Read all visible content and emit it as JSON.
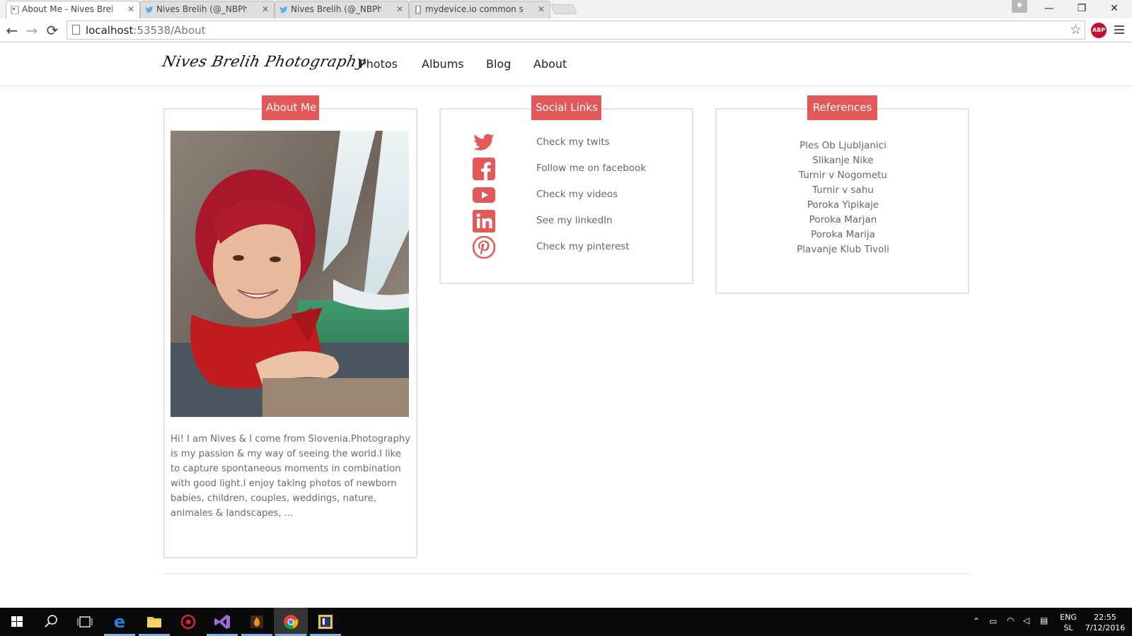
{
  "browser": {
    "tabs": [
      {
        "title": "About Me - Nives Brelih P",
        "active": true
      },
      {
        "title": "Nives Brelih (@_NBPhotog",
        "active": false
      },
      {
        "title": "Nives Brelih (@_NBPhotog",
        "active": false
      },
      {
        "title": "mydevice.io common sma",
        "active": false
      }
    ],
    "url_host": "localhost",
    "url_rest": ":53538/About",
    "window_controls": {
      "minimize": "—",
      "restore": "❐",
      "close": "✕"
    },
    "extension_label": "ABP"
  },
  "site": {
    "logo": "Nives Brelih Photography",
    "nav": [
      "Photos",
      "Albums",
      "Blog",
      "About"
    ],
    "accent_color": "#e4585a",
    "about": {
      "title": "About Me",
      "text": "Hi! I am Nives & I come from Slovenia.Photography is my passion & my way of seeing the world.I like to capture spontaneous moments in combination with good light.I enjoy taking photos of newborn babies, children, couples, weddings, nature, animales & landscapes, ..."
    },
    "social": {
      "title": "Social Links",
      "links": [
        {
          "icon": "twitter-icon",
          "label": "Check my twits"
        },
        {
          "icon": "facebook-icon",
          "label": "Follow me on facebook"
        },
        {
          "icon": "youtube-icon",
          "label": "Check my videos"
        },
        {
          "icon": "linkedin-icon",
          "label": "See my linkedIn"
        },
        {
          "icon": "pinterest-icon",
          "label": "Check my pinterest"
        }
      ]
    },
    "references": {
      "title": "References",
      "items": [
        "Ples Ob Ljubljanici",
        "Slikanje Nike",
        "Turnir v Nogometu",
        "Turnir v sahu",
        "Poroka Yipikaje",
        "Poroka Marjan",
        "Poroka Marija",
        "Plavanje Klub Tivoli"
      ]
    }
  },
  "taskbar": {
    "lang_top": "ENG",
    "lang_bottom": "SL",
    "time": "22:55",
    "date": "7/12/2016"
  }
}
